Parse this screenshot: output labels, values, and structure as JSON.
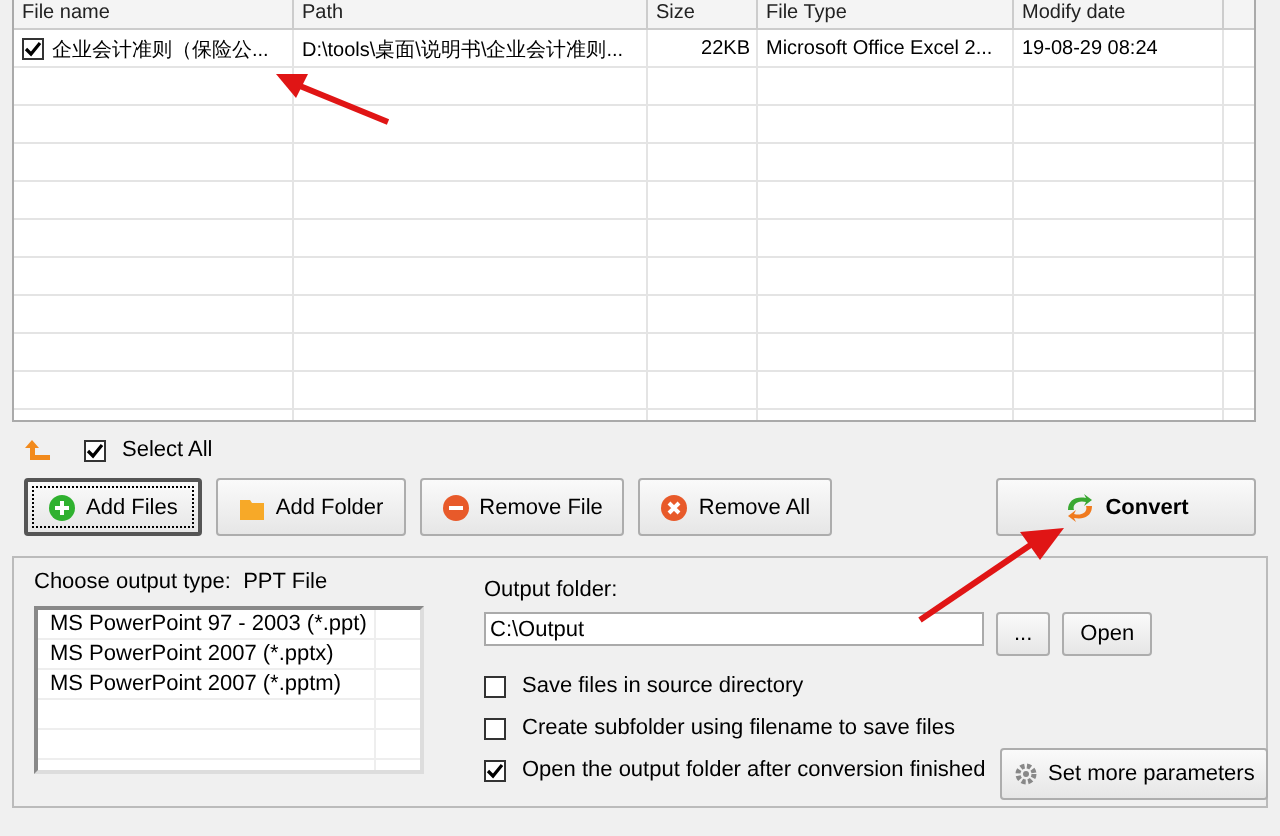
{
  "file_table": {
    "columns": [
      "File name",
      "Path",
      "Size",
      "File Type",
      "Modify date"
    ],
    "rows": [
      {
        "checked": true,
        "cells": [
          "企业会计准则（保险公...",
          "D:\\tools\\桌面\\说明书\\企业会计准则...",
          "22KB",
          "Microsoft Office Excel 2...",
          "19-08-29 08:24"
        ]
      }
    ]
  },
  "select_all": {
    "label": "Select All",
    "checked": true
  },
  "buttons": [
    {
      "kind": "add",
      "label": "Add Files",
      "selected": true
    },
    {
      "kind": "folder",
      "label": "Add Folder",
      "selected": false
    },
    {
      "kind": "remove",
      "label": "Remove File",
      "selected": false
    },
    {
      "kind": "clear",
      "label": "Remove All",
      "selected": false
    }
  ],
  "convert_button": {
    "label": "Convert"
  },
  "output_type": {
    "label": "Choose output type:",
    "value": "PPT File",
    "options": [
      "MS PowerPoint 97 - 2003 (*.ppt)",
      "MS PowerPoint 2007 (*.pptx)",
      "MS PowerPoint 2007 (*.pptm)"
    ]
  },
  "output_folder": {
    "label": "Output folder:",
    "value": "C:\\Output",
    "browse": "...",
    "open": "Open"
  },
  "options": [
    {
      "label": "Save files in source directory",
      "checked": false
    },
    {
      "label": "Create subfolder using filename to save files",
      "checked": false
    },
    {
      "label": "Open the output folder after conversion finished",
      "checked": true
    }
  ],
  "more_button": {
    "label": "Set more parameters"
  }
}
